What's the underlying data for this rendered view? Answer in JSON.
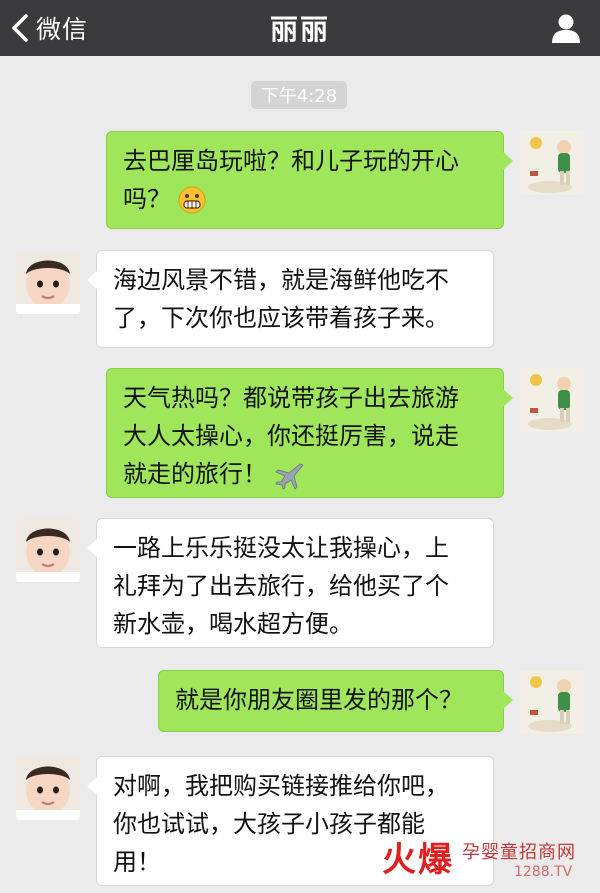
{
  "nav": {
    "back_label": "微信",
    "title": "丽丽",
    "back_icon": "chevron-left-icon",
    "profile_icon": "person-icon"
  },
  "time_label": "下午4:28",
  "messages": [
    {
      "side": "sent",
      "lines": [
        "去巴厘岛玩啦？和儿子玩的开心",
        "吗？"
      ],
      "emoji": "grinning-face-emoji"
    },
    {
      "side": "received",
      "lines": [
        "海边风景不错，就是海鲜他吃不",
        "了，下次你也应该带着孩子来。"
      ]
    },
    {
      "side": "sent",
      "lines": [
        "天气热吗？都说带孩子出去旅游",
        "大人太操心，你还挺厉害，说走",
        "就走的旅行！"
      ],
      "emoji": "airplane-emoji"
    },
    {
      "side": "received",
      "lines": [
        "一路上乐乐挺没太让我操心，上",
        "礼拜为了出去旅行，给他买了个",
        "新水壶，喝水超方便。"
      ]
    },
    {
      "side": "sent",
      "lines": [
        "就是你朋友圈里发的那个？"
      ]
    },
    {
      "side": "received",
      "lines": [
        "对啊，我把购买链接推给你吧，",
        "你也试试，大孩子小孩子都能",
        "用！"
      ]
    }
  ],
  "watermark": {
    "logo": "火爆",
    "text": "孕婴童招商网",
    "url": "1288.TV"
  },
  "colors": {
    "navbar": "#3a3a3f",
    "background": "#ebebeb",
    "sent_bubble": "#9fe65a",
    "received_bubble": "#ffffff"
  }
}
